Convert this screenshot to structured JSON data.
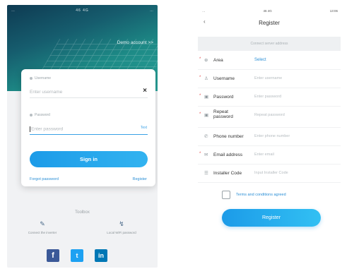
{
  "login_screen": {
    "status_bar": {
      "left": "…",
      "signal": "46 4G",
      "right": "…"
    },
    "demo_account_link": "Demo account >>",
    "username": {
      "label": "Username",
      "placeholder": "Enter username"
    },
    "password": {
      "label": "Password",
      "placeholder": "Enter password",
      "toggle": "Text"
    },
    "clear_icon": "×",
    "sign_in_label": "Sign in",
    "forgot_password_label": "Forgot password",
    "register_label": "Register",
    "toolbox": {
      "title": "Toolbox",
      "items": [
        {
          "icon": "connect-icon",
          "glyph": "✎",
          "label": "Connect the inverter"
        },
        {
          "icon": "wifi-icon",
          "glyph": "↯",
          "label": "Local WiFi password"
        }
      ]
    },
    "social": [
      {
        "name": "facebook",
        "glyph": "f"
      },
      {
        "name": "twitter",
        "glyph": "t"
      },
      {
        "name": "linkedin",
        "glyph": "in"
      }
    ],
    "footer": ""
  },
  "register_screen": {
    "status_bar": {
      "left": "…",
      "signal": "46 4G",
      "right": "13:06"
    },
    "back_icon": "‹",
    "title": "Register",
    "banner_text": "Connect server address",
    "rows": [
      {
        "key": "area",
        "required": true,
        "icon": "globe-icon",
        "glyph": "⊕",
        "label": "Area",
        "value": "Select",
        "value_is_link": true
      },
      {
        "key": "username",
        "required": true,
        "icon": "user-icon",
        "glyph": "♙",
        "label": "Username",
        "value": "Enter username",
        "value_is_link": false
      },
      {
        "key": "password",
        "required": true,
        "icon": "lock-icon",
        "glyph": "▣",
        "label": "Password",
        "value": "Enter password",
        "value_is_link": false
      },
      {
        "key": "repeat_password",
        "required": true,
        "icon": "lock-icon",
        "glyph": "▣",
        "label": "Repeat password",
        "value": "Repeat password",
        "value_is_link": false
      },
      {
        "key": "phone",
        "required": false,
        "icon": "phone-icon",
        "glyph": "✆",
        "label": "Phone number",
        "value": "Enter phone number",
        "value_is_link": false
      },
      {
        "key": "email",
        "required": true,
        "icon": "mail-icon",
        "glyph": "✉",
        "label": "Email address",
        "value": "Enter email",
        "value_is_link": false
      },
      {
        "key": "installer",
        "required": false,
        "icon": "code-icon",
        "glyph": "☰",
        "label": "Installer Code",
        "value": "Input Installer Code",
        "value_is_link": false
      }
    ],
    "required_marker": "*",
    "terms_label": "Terms and conditions agreed",
    "register_button_label": "Register"
  }
}
